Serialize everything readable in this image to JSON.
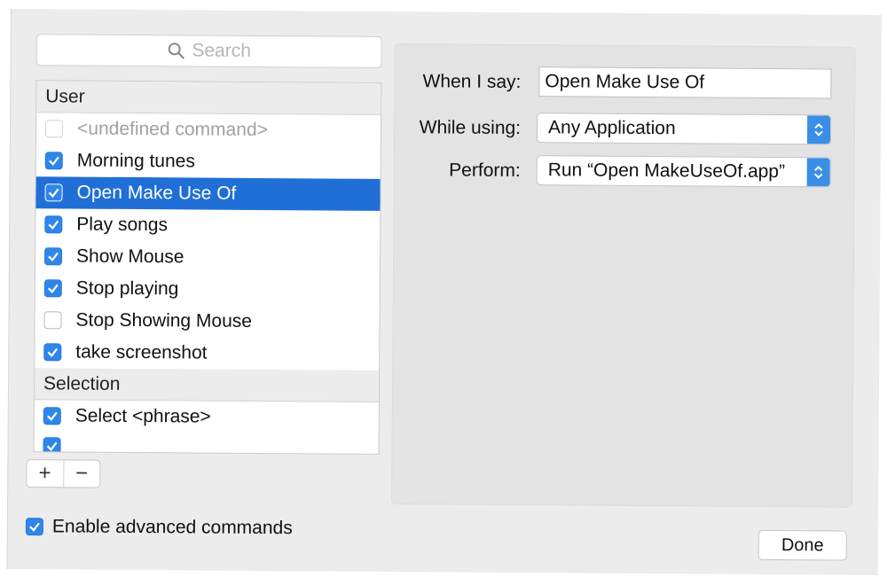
{
  "search": {
    "placeholder": "Search"
  },
  "list": {
    "sections": [
      {
        "header": "User",
        "items": [
          {
            "label": "<undefined command>",
            "checked": false,
            "selected": false,
            "disabled": true
          },
          {
            "label": "Morning tunes",
            "checked": true,
            "selected": false,
            "disabled": false
          },
          {
            "label": "Open Make Use Of",
            "checked": true,
            "selected": true,
            "disabled": false
          },
          {
            "label": "Play songs",
            "checked": true,
            "selected": false,
            "disabled": false
          },
          {
            "label": "Show Mouse",
            "checked": true,
            "selected": false,
            "disabled": false
          },
          {
            "label": "Stop playing",
            "checked": true,
            "selected": false,
            "disabled": false
          },
          {
            "label": "Stop Showing Mouse",
            "checked": false,
            "selected": false,
            "disabled": false
          },
          {
            "label": "take screenshot",
            "checked": true,
            "selected": false,
            "disabled": false
          }
        ]
      },
      {
        "header": "Selection",
        "items": [
          {
            "label": "Select <phrase>",
            "checked": true,
            "selected": false,
            "disabled": false
          }
        ]
      }
    ]
  },
  "buttons": {
    "add": "+",
    "remove": "−",
    "done": "Done"
  },
  "detail": {
    "when_label": "When I say:",
    "when_value": "Open Make Use Of",
    "while_label": "While using:",
    "while_value": "Any Application",
    "perform_label": "Perform:",
    "perform_value": "Run “Open MakeUseOf.app”"
  },
  "advanced": {
    "label": "Enable advanced commands",
    "checked": true
  },
  "colors": {
    "selection": "#1f6fd6",
    "checkbox": "#2f86ea",
    "panel": "#ececec"
  }
}
